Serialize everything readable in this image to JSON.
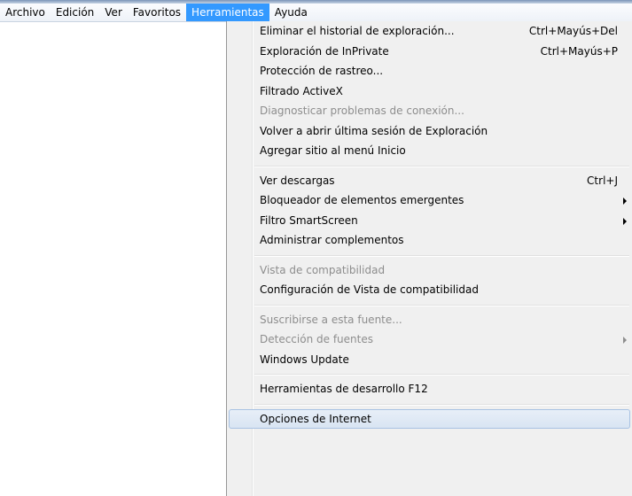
{
  "menubar": {
    "items": [
      {
        "label": "Archivo"
      },
      {
        "label": "Edición"
      },
      {
        "label": "Ver"
      },
      {
        "label": "Favoritos"
      },
      {
        "label": "Herramientas"
      },
      {
        "label": "Ayuda"
      }
    ]
  },
  "tools_menu": {
    "items": [
      {
        "label": "Eliminar el historial de exploración...",
        "shortcut": "Ctrl+Mayús+Del"
      },
      {
        "label": "Exploración de InPrivate",
        "shortcut": "Ctrl+Mayús+P"
      },
      {
        "label": "Protección de rastreo..."
      },
      {
        "label": "Filtrado ActiveX"
      },
      {
        "label": "Diagnosticar problemas de conexión..."
      },
      {
        "label": "Volver a abrir última sesión de Exploración"
      },
      {
        "label": "Agregar sitio al menú Inicio"
      },
      {
        "label": "Ver descargas",
        "shortcut": "Ctrl+J"
      },
      {
        "label": "Bloqueador de elementos emergentes"
      },
      {
        "label": "Filtro SmartScreen"
      },
      {
        "label": "Administrar complementos"
      },
      {
        "label": "Vista de compatibilidad"
      },
      {
        "label": "Configuración de Vista de compatibilidad"
      },
      {
        "label": "Suscribirse a esta fuente..."
      },
      {
        "label": "Detección de fuentes"
      },
      {
        "label": "Windows Update"
      },
      {
        "label": "Herramientas de desarrollo F12"
      },
      {
        "label": "Opciones de Internet"
      }
    ]
  },
  "icons": {
    "submenu_arrow": "chevron-right-icon"
  },
  "colors": {
    "menubar_active": "#3399ff",
    "menu_background": "#f0f0f0",
    "disabled_text": "#8d8d8d",
    "hover_border": "#a8c2e3"
  }
}
